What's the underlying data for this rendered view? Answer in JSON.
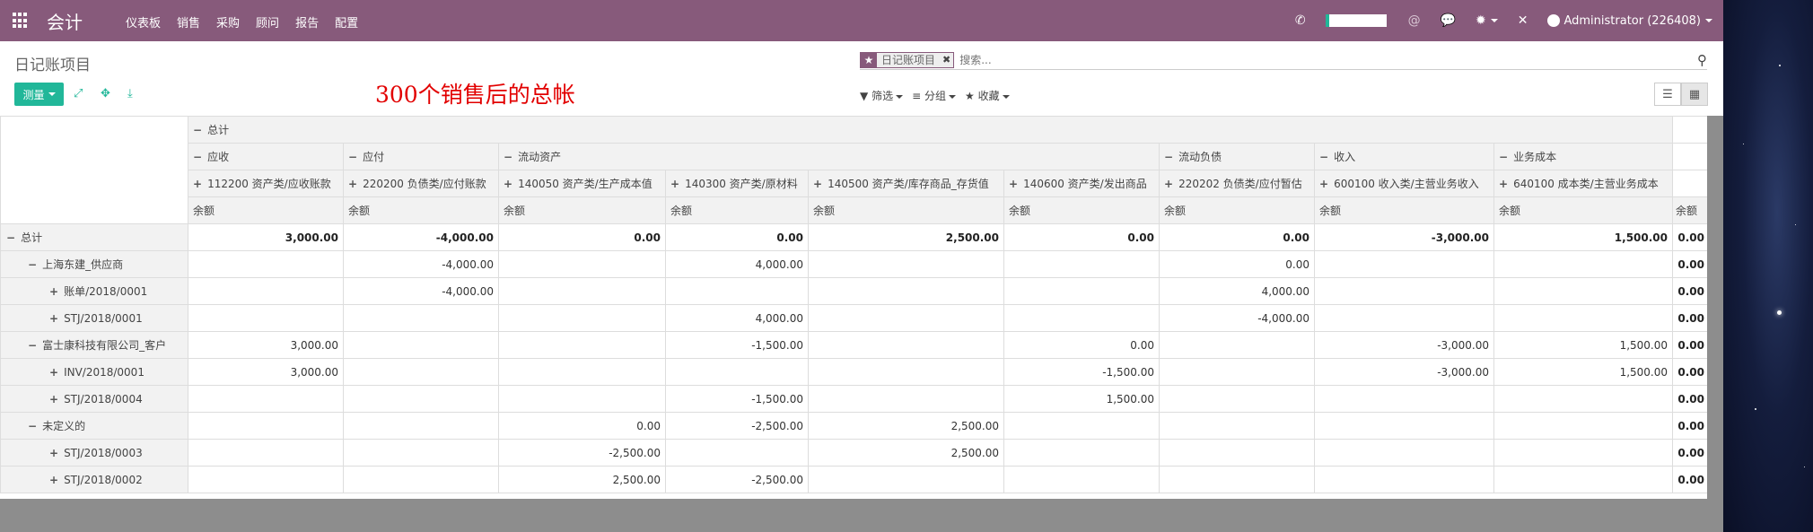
{
  "navbar": {
    "brand": "会计",
    "menu": [
      "仪表板",
      "销售",
      "采购",
      "顾问",
      "报告",
      "配置"
    ],
    "user": "Administrator (226408)"
  },
  "breadcrumb": "日记账项目",
  "measure_button": "测量",
  "annotation": "300个销售后的总帐",
  "search": {
    "facet": "日记账项目",
    "placeholder": "搜索..."
  },
  "filters": {
    "filter": "筛选",
    "group": "分组",
    "favorites": "收藏"
  },
  "pivot": {
    "top_header": "总计",
    "groups": [
      {
        "label": "应收",
        "span": 1
      },
      {
        "label": "应付",
        "span": 1
      },
      {
        "label": "流动资产",
        "span": 4
      },
      {
        "label": "流动负债",
        "span": 1
      },
      {
        "label": "收入",
        "span": 1
      },
      {
        "label": "业务成本",
        "span": 1
      }
    ],
    "accounts": [
      "112200 资产类/应收账款",
      "220200 负债类/应付账款",
      "140050 资产类/生产成本值",
      "140300 资产类/原材料",
      "140500 资产类/库存商品_存货值",
      "140600 资产类/发出商品",
      "220202 负债类/应付暂估",
      "600100 收入类/主营业务收入",
      "640100 成本类/主营业务成本"
    ],
    "measure": "余额",
    "rows": [
      {
        "label": "总计",
        "level": 0,
        "sign": "−",
        "bold": true,
        "values": [
          "3,000.00",
          "-4,000.00",
          "0.00",
          "0.00",
          "2,500.00",
          "0.00",
          "0.00",
          "-3,000.00",
          "1,500.00"
        ],
        "total": "0.00"
      },
      {
        "label": "上海东建_供应商",
        "level": 1,
        "sign": "−",
        "bold": false,
        "values": [
          "",
          "-4,000.00",
          "",
          "4,000.00",
          "",
          "",
          "0.00",
          "",
          ""
        ],
        "total": "0.00"
      },
      {
        "label": "账单/2018/0001",
        "level": 2,
        "sign": "+",
        "bold": false,
        "values": [
          "",
          "-4,000.00",
          "",
          "",
          "",
          "",
          "4,000.00",
          "",
          ""
        ],
        "total": "0.00"
      },
      {
        "label": "STJ/2018/0001",
        "level": 2,
        "sign": "+",
        "bold": false,
        "values": [
          "",
          "",
          "",
          "4,000.00",
          "",
          "",
          "-4,000.00",
          "",
          ""
        ],
        "total": "0.00"
      },
      {
        "label": "富士康科技有限公司_客户",
        "level": 1,
        "sign": "−",
        "bold": false,
        "values": [
          "3,000.00",
          "",
          "",
          "-1,500.00",
          "",
          "0.00",
          "",
          "-3,000.00",
          "1,500.00"
        ],
        "total": "0.00"
      },
      {
        "label": "INV/2018/0001",
        "level": 2,
        "sign": "+",
        "bold": false,
        "values": [
          "3,000.00",
          "",
          "",
          "",
          "",
          "-1,500.00",
          "",
          "-3,000.00",
          "1,500.00"
        ],
        "total": "0.00"
      },
      {
        "label": "STJ/2018/0004",
        "level": 2,
        "sign": "+",
        "bold": false,
        "values": [
          "",
          "",
          "",
          "-1,500.00",
          "",
          "1,500.00",
          "",
          "",
          ""
        ],
        "total": "0.00"
      },
      {
        "label": "未定义的",
        "level": 1,
        "sign": "−",
        "bold": false,
        "values": [
          "",
          "",
          "0.00",
          "-2,500.00",
          "2,500.00",
          "",
          "",
          "",
          ""
        ],
        "total": "0.00"
      },
      {
        "label": "STJ/2018/0003",
        "level": 2,
        "sign": "+",
        "bold": false,
        "values": [
          "",
          "",
          "-2,500.00",
          "",
          "2,500.00",
          "",
          "",
          "",
          ""
        ],
        "total": "0.00"
      },
      {
        "label": "STJ/2018/0002",
        "level": 2,
        "sign": "+",
        "bold": false,
        "values": [
          "",
          "",
          "2,500.00",
          "-2,500.00",
          "",
          "",
          "",
          "",
          ""
        ],
        "total": "0.00"
      }
    ]
  }
}
